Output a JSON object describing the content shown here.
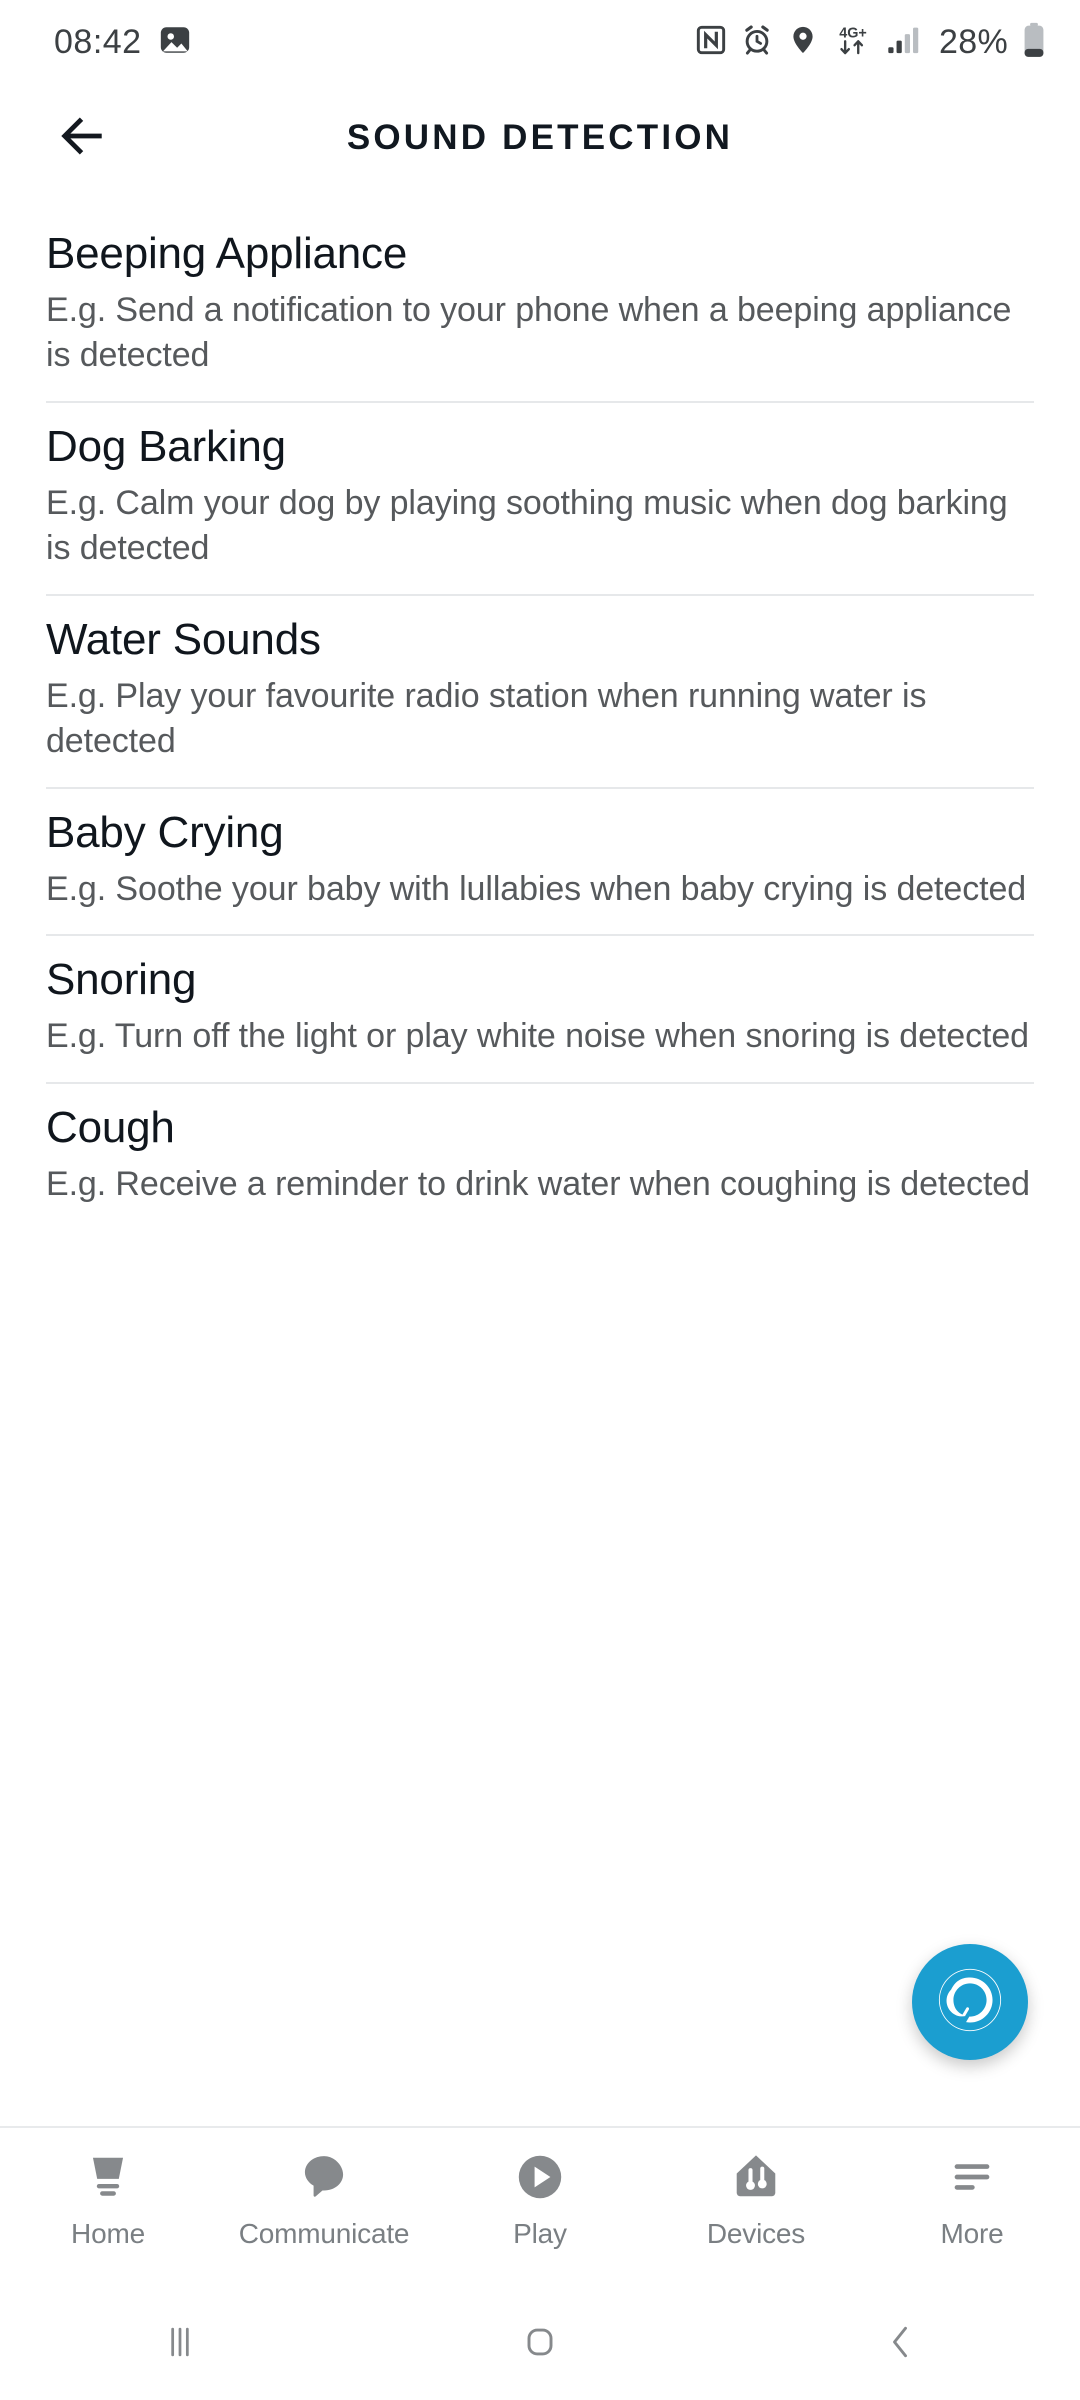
{
  "status_bar": {
    "time": "08:42",
    "left_icons": [
      "image-icon"
    ],
    "right_icons": [
      "nfc-icon",
      "alarm-icon",
      "location-icon",
      "network-4g-plus-icon",
      "signal-bars-icon"
    ],
    "network_label": "4G+",
    "battery_percent": "28%"
  },
  "header": {
    "back_label": "back-arrow-icon",
    "title": "SOUND DETECTION"
  },
  "sounds": [
    {
      "title": "Beeping Appliance",
      "description": "E.g. Send a notification to your phone when a beeping appliance is detected"
    },
    {
      "title": "Dog Barking",
      "description": "E.g. Calm your dog by playing soothing music when dog barking is detected"
    },
    {
      "title": "Water Sounds",
      "description": "E.g. Play your favourite radio station when running water is detected"
    },
    {
      "title": "Baby Crying",
      "description": "E.g. Soothe your baby with lullabies when baby crying is detected"
    },
    {
      "title": "Snoring",
      "description": "E.g. Turn off the light or play white noise when snoring is detected"
    },
    {
      "title": "Cough",
      "description": "E.g. Receive a reminder to drink water when coughing is detected"
    }
  ],
  "alexa_button": {
    "name": "alexa-icon",
    "color": "#1b9ed0"
  },
  "bottom_nav": {
    "items": [
      {
        "label": "Home",
        "icon": "home-echo-icon"
      },
      {
        "label": "Communicate",
        "icon": "speech-bubble-icon"
      },
      {
        "label": "Play",
        "icon": "play-circle-icon"
      },
      {
        "label": "Devices",
        "icon": "devices-house-icon"
      },
      {
        "label": "More",
        "icon": "more-lines-icon"
      }
    ]
  },
  "system_nav": {
    "recents": "recents-icon",
    "home": "home-square-icon",
    "back": "back-chevron-icon"
  },
  "colors": {
    "accent": "#1b9ed0",
    "title_text": "#10161d",
    "body_text": "#56595c",
    "divider": "#e6e8ea",
    "nav_inactive": "#7a7f83"
  }
}
